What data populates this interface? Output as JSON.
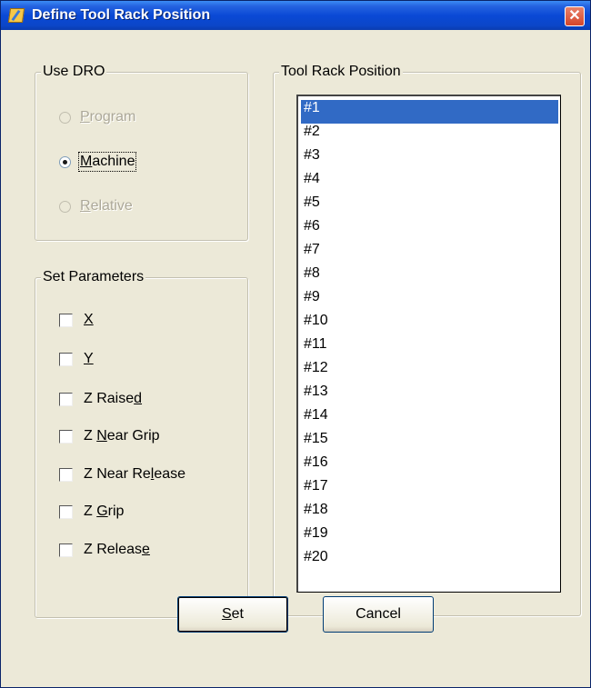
{
  "window": {
    "title": "Define Tool Rack Position",
    "close_glyph": "✕"
  },
  "use_dro": {
    "legend": "Use DRO",
    "options": [
      {
        "label": "Program",
        "mnemonic": "P",
        "rest": "rogram",
        "checked": false,
        "enabled": false
      },
      {
        "label": "Machine",
        "mnemonic": "M",
        "rest": "achine",
        "checked": true,
        "enabled": true
      },
      {
        "label": "Relative",
        "mnemonic": "R",
        "rest": "elative",
        "checked": false,
        "enabled": false
      }
    ]
  },
  "set_parameters": {
    "legend": "Set Parameters",
    "items": [
      {
        "label": "X",
        "pre": "",
        "mnemonic": "X",
        "post": "",
        "checked": false
      },
      {
        "label": "Y",
        "pre": "",
        "mnemonic": "Y",
        "post": "",
        "checked": false
      },
      {
        "label": "Z Raised",
        "pre": "Z Raise",
        "mnemonic": "d",
        "post": "",
        "checked": false
      },
      {
        "label": "Z Near Grip",
        "pre": "Z ",
        "mnemonic": "N",
        "post": "ear Grip",
        "checked": false
      },
      {
        "label": "Z Near Release",
        "pre": "Z Near Re",
        "mnemonic": "l",
        "post": "ease",
        "checked": false
      },
      {
        "label": "Z Grip",
        "pre": "Z ",
        "mnemonic": "G",
        "post": "rip",
        "checked": false
      },
      {
        "label": "Z Release",
        "pre": "Z Releas",
        "mnemonic": "e",
        "post": "",
        "checked": false
      }
    ]
  },
  "tool_rack": {
    "legend": "Tool Rack Position",
    "selected_index": 0,
    "items": [
      "#1",
      "#2",
      "#3",
      "#4",
      "#5",
      "#6",
      "#7",
      "#8",
      "#9",
      "#10",
      "#11",
      "#12",
      "#13",
      "#14",
      "#15",
      "#16",
      "#17",
      "#18",
      "#19",
      "#20"
    ]
  },
  "buttons": {
    "set": {
      "mnemonic": "S",
      "rest": "et"
    },
    "cancel": "Cancel"
  },
  "colors": {
    "selection": "#316ac5",
    "dialog_bg": "#ece9d8",
    "titlebar": "#0a49d6",
    "close": "#d5452a"
  }
}
